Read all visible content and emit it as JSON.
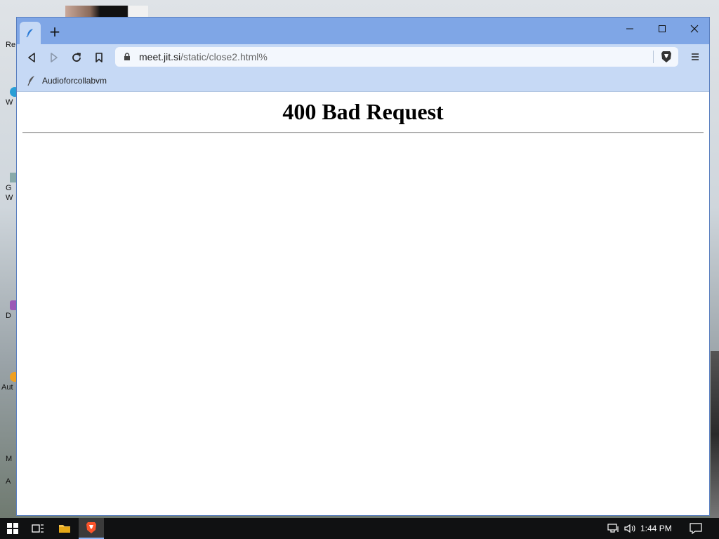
{
  "browser": {
    "url_host": "meet.jit.si",
    "url_path": "/static/close2.html%",
    "bookmark_label": "Audioforcollabvm",
    "new_tab_label": "+",
    "accent_color": "#7fa6e6",
    "toolbar_color": "#c6d9f5"
  },
  "page": {
    "heading": "400 Bad Request"
  },
  "desktop": {
    "icon_labels": [
      "Re",
      "W",
      "G",
      "W",
      "D",
      "Aut",
      "M",
      "A"
    ]
  },
  "taskbar": {
    "time": "1:44 PM",
    "apps": [
      "start-icon",
      "task-view-icon",
      "file-explorer-icon",
      "brave-browser-icon"
    ],
    "tray": [
      "network-icon",
      "volume-icon",
      "notification-icon"
    ]
  }
}
